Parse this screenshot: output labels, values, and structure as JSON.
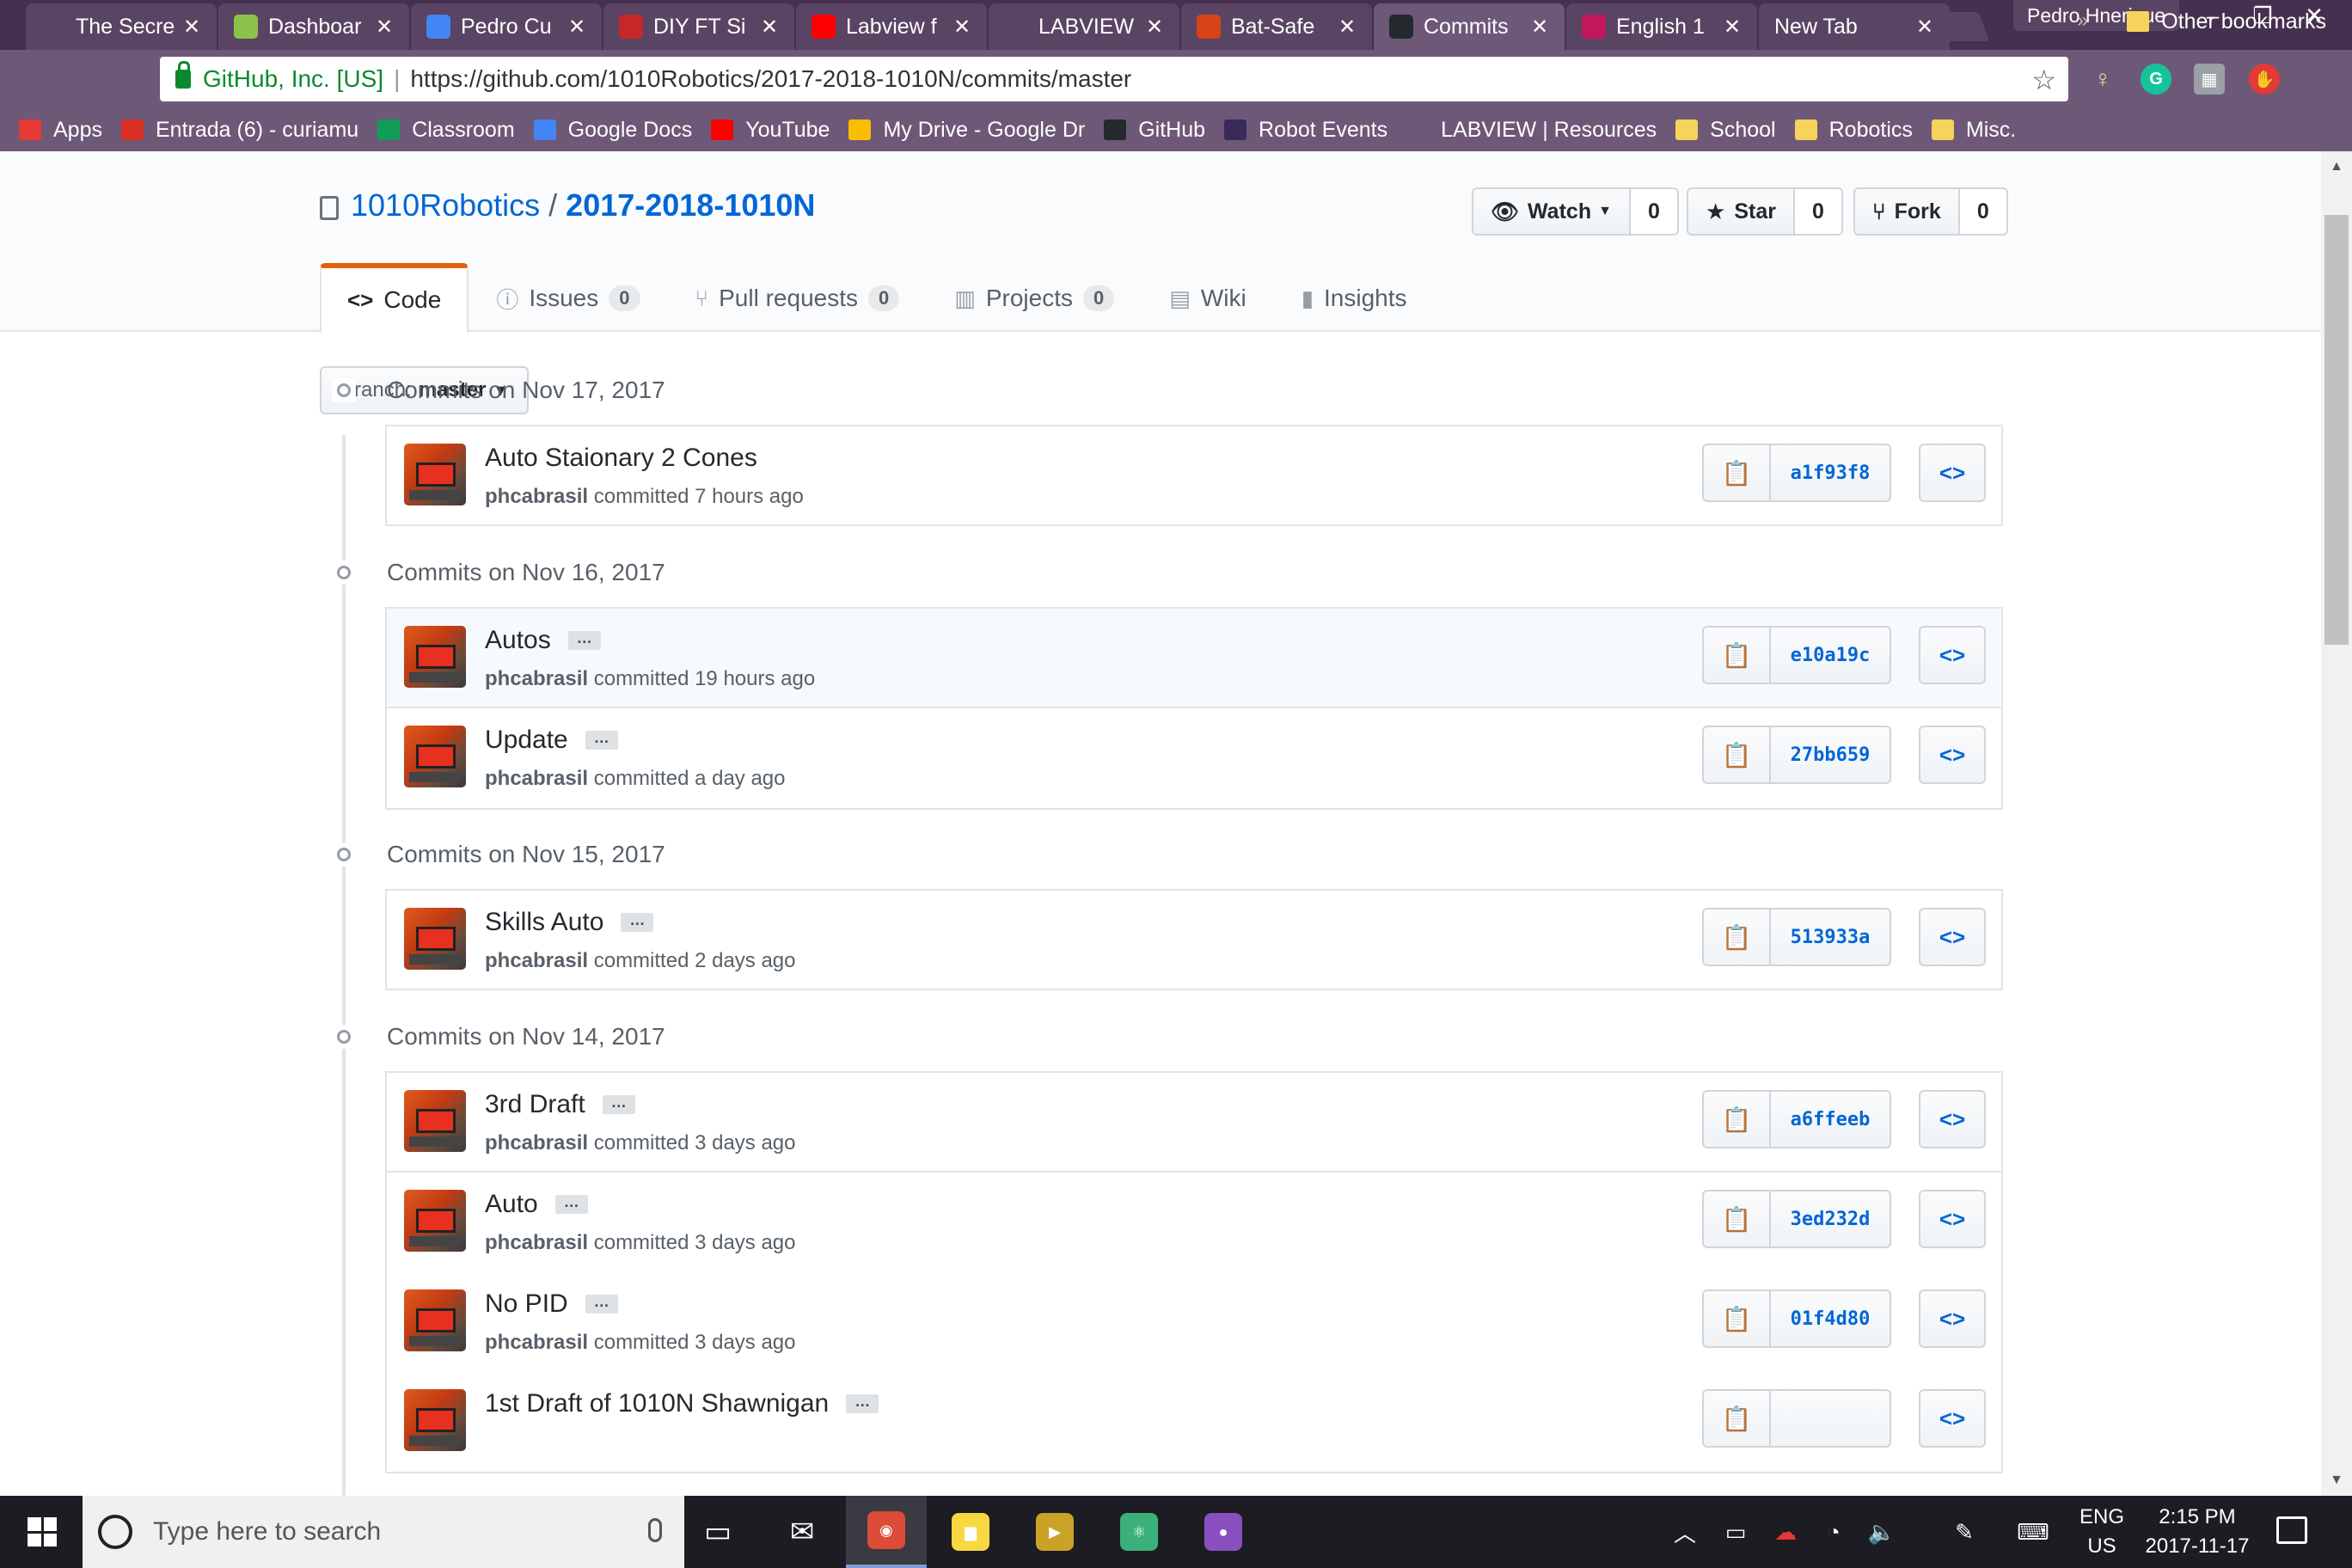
{
  "browser": {
    "tabs": [
      {
        "title": "The Secre",
        "icon": "doc-icon",
        "color": "#5a4463"
      },
      {
        "title": "Dashboar",
        "icon": "leaf-icon",
        "color": "#8bc34a"
      },
      {
        "title": "Pedro Cu",
        "icon": "google-docs-icon",
        "color": "#4285f4"
      },
      {
        "title": "DIY FT Si",
        "icon": "diy-icon",
        "color": "#c62828"
      },
      {
        "title": "Labview f",
        "icon": "youtube-icon",
        "color": "#ff0000"
      },
      {
        "title": "LABVIEW",
        "icon": "doc-icon",
        "color": "#5a4463"
      },
      {
        "title": "Bat-Safe",
        "icon": "bat-icon",
        "color": "#d84315"
      },
      {
        "title": "Commits",
        "icon": "github-icon",
        "color": "#24292e",
        "active": true
      },
      {
        "title": "English 1",
        "icon": "classroom-icon",
        "color": "#c2185b"
      },
      {
        "title": "New Tab",
        "icon": "",
        "color": ""
      }
    ],
    "profile_name": "Pedro Hnerique",
    "window_controls": {
      "minimize": "–",
      "restore": "❐",
      "close": "✕"
    },
    "omnibox": {
      "secure_label": "GitHub, Inc. [US]",
      "separator": "|",
      "url": "https://github.com/1010Robotics/2017-2018-1010N/commits/master"
    },
    "bookmarks": [
      {
        "label": "Apps",
        "icon": "apps-grid-icon",
        "color": "#e53935"
      },
      {
        "label": "Entrada (6) - curiamu",
        "icon": "gmail-icon",
        "color": "#d93025"
      },
      {
        "label": "Classroom",
        "icon": "classroom-icon",
        "color": "#0f9d58"
      },
      {
        "label": "Google Docs",
        "icon": "google-docs-icon",
        "color": "#4285f4"
      },
      {
        "label": "YouTube",
        "icon": "youtube-icon",
        "color": "#ff0000"
      },
      {
        "label": "My Drive - Google Dr",
        "icon": "drive-icon",
        "color": "#fbbc04"
      },
      {
        "label": "GitHub",
        "icon": "github-icon",
        "color": "#24292e"
      },
      {
        "label": "Robot Events",
        "icon": "robot-events-icon",
        "color": "#3a2a5a"
      },
      {
        "label": "LABVIEW | Resources",
        "icon": "doc-icon",
        "color": "#6e5878"
      },
      {
        "label": "School",
        "icon": "folder-icon",
        "color": "#f6d35c"
      },
      {
        "label": "Robotics",
        "icon": "folder-icon",
        "color": "#f6d35c"
      },
      {
        "label": "Misc.",
        "icon": "folder-icon",
        "color": "#f6d35c"
      }
    ],
    "bookmarks_more": "»",
    "other_bookmarks": "Other bookmarks"
  },
  "repo": {
    "owner": "1010Robotics",
    "separator": "/",
    "name": "2017-2018-1010N",
    "watch": {
      "label": "Watch",
      "count": "0"
    },
    "star": {
      "label": "Star",
      "count": "0"
    },
    "fork": {
      "label": "Fork",
      "count": "0"
    },
    "nav": [
      {
        "label": "Code",
        "icon": "code-icon",
        "counter": null,
        "selected": true
      },
      {
        "label": "Issues",
        "icon": "issue-icon",
        "counter": "0"
      },
      {
        "label": "Pull requests",
        "icon": "pull-request-icon",
        "counter": "0"
      },
      {
        "label": "Projects",
        "icon": "project-icon",
        "counter": "0"
      },
      {
        "label": "Wiki",
        "icon": "book-icon",
        "counter": null
      },
      {
        "label": "Insights",
        "icon": "graph-icon",
        "counter": null
      }
    ],
    "branch": {
      "prefix": "Branch:",
      "name": "master"
    }
  },
  "commit_groups": [
    {
      "date": "Commits on Nov 17, 2017",
      "commits": [
        {
          "message": "Auto Staionary 2 Cones",
          "author": "phcabrasil",
          "committed": "committed 7 hours ago",
          "sha": "a1f93f8",
          "ellipsis": false
        }
      ]
    },
    {
      "date": "Commits on Nov 16, 2017",
      "commits": [
        {
          "message": "Autos",
          "author": "phcabrasil",
          "committed": "committed 19 hours ago",
          "sha": "e10a19c",
          "ellipsis": true,
          "highlight": true
        },
        {
          "message": "Update",
          "author": "phcabrasil",
          "committed": "committed a day ago",
          "sha": "27bb659",
          "ellipsis": true
        }
      ]
    },
    {
      "date": "Commits on Nov 15, 2017",
      "commits": [
        {
          "message": "Skills Auto",
          "author": "phcabrasil",
          "committed": "committed 2 days ago",
          "sha": "513933a",
          "ellipsis": true
        }
      ]
    },
    {
      "date": "Commits on Nov 14, 2017",
      "commits": [
        {
          "message": "3rd Draft",
          "author": "phcabrasil",
          "committed": "committed 3 days ago",
          "sha": "a6ffeeb",
          "ellipsis": true
        },
        {
          "message": "Auto",
          "author": "phcabrasil",
          "committed": "committed 3 days ago",
          "sha": "3ed232d",
          "ellipsis": true
        },
        {
          "message": "No PID",
          "author": "phcabrasil",
          "committed": "committed 3 days ago",
          "sha": "01f4d80",
          "ellipsis": true
        },
        {
          "message": "1st Draft of 1010N Shawnigan",
          "author": "",
          "committed": "",
          "sha": "",
          "ellipsis": true
        }
      ]
    }
  ],
  "commit_ellipsis": "…",
  "taskbar": {
    "search_placeholder": "Type here to search",
    "apps": [
      {
        "name": "task-view-icon",
        "color": "#1c1c22",
        "running": false
      },
      {
        "name": "mail-icon",
        "color": "#1c1c22",
        "running": false
      },
      {
        "name": "chrome-icon",
        "color": "#dd4b39",
        "running": true
      },
      {
        "name": "sticky-notes-icon",
        "color": "#f7d840",
        "running": false
      },
      {
        "name": "media-icon",
        "color": "#c9a227",
        "running": false
      },
      {
        "name": "atom-icon",
        "color": "#3bb07a",
        "running": false
      },
      {
        "name": "github-desktop-icon",
        "color": "#8a4fbf",
        "running": false
      }
    ],
    "language": [
      "ENG",
      "US"
    ],
    "time": "2:15 PM",
    "date": "2017-11-17"
  }
}
